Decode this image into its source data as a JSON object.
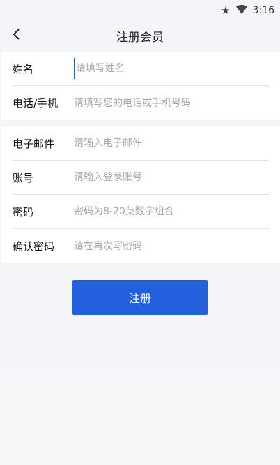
{
  "status_bar": {
    "time": "3:16",
    "icons": [
      "star-icon",
      "wifi-icon"
    ]
  },
  "header": {
    "title": "注册会员",
    "back_icon": "chevron-left-icon"
  },
  "form": {
    "section1": [
      {
        "label": "姓名",
        "placeholder": "请填写姓名",
        "value": ""
      },
      {
        "label": "电话/手机",
        "placeholder": "请填写您的电话或手机号码",
        "value": ""
      }
    ],
    "section2": [
      {
        "label": "电子邮件",
        "placeholder": "请输入电子邮件",
        "value": ""
      },
      {
        "label": "账号",
        "placeholder": "请输入登录账号",
        "value": ""
      },
      {
        "label": "密码",
        "placeholder": "密码为8-20英数字组合",
        "value": ""
      },
      {
        "label": "确认密码",
        "placeholder": "请在再次写密码",
        "value": ""
      }
    ]
  },
  "submit_label": "注册",
  "colors": {
    "accent": "#2360dd",
    "background": "#f4f5f8",
    "card": "#ffffff"
  }
}
